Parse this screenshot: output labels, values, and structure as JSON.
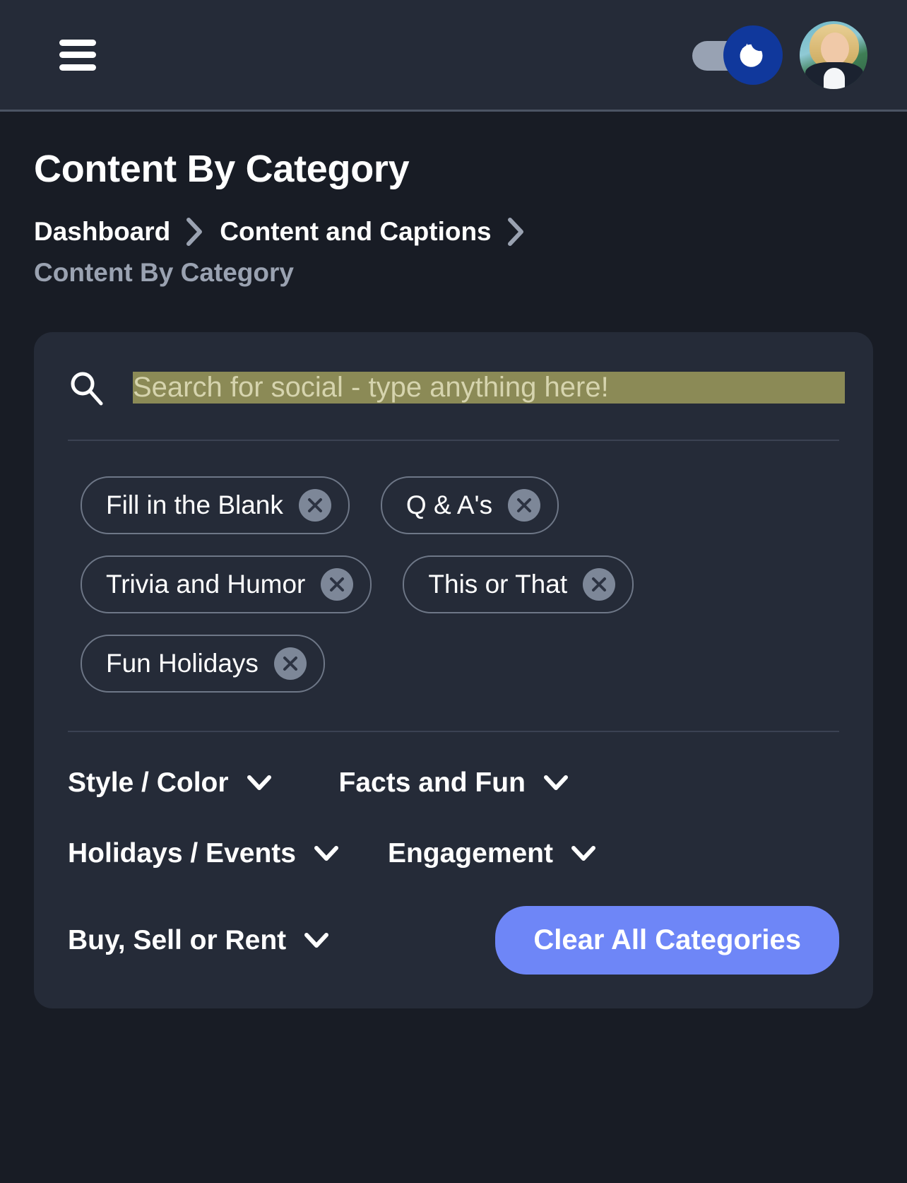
{
  "appbar": {
    "menu_icon": "hamburger-menu-icon",
    "dark_mode_toggle": {
      "icon": "moon-sparkle-icon",
      "state": "on",
      "knob_color": "#10389c",
      "track_color": "#98a2b3"
    },
    "avatar_alt": "user-avatar"
  },
  "page": {
    "title": "Content By Category"
  },
  "breadcrumb": {
    "items": [
      {
        "label": "Dashboard",
        "current": false
      },
      {
        "label": "Content and Captions",
        "current": false
      },
      {
        "label": "Content By Category",
        "current": true
      }
    ],
    "separator_icon": "chevron-right-icon"
  },
  "search": {
    "icon": "search-icon",
    "value": "",
    "placeholder": "Search for social - type anything here!",
    "placeholder_highlight_color": "#8b8a56",
    "placeholder_text_color": "#d6d4ae"
  },
  "chips": {
    "remove_icon": "close-circle-icon",
    "rows": [
      [
        {
          "label": "Fill in the Blank"
        },
        {
          "label": "Q & A's"
        }
      ],
      [
        {
          "label": "Trivia and Humor"
        },
        {
          "label": "This or That"
        }
      ],
      [
        {
          "label": "Fun Holidays"
        }
      ]
    ]
  },
  "dropdowns": {
    "caret_icon": "chevron-down-icon",
    "rows": [
      [
        {
          "label": "Style / Color"
        },
        {
          "label": "Facts and Fun"
        }
      ],
      [
        {
          "label": "Holidays / Events"
        },
        {
          "label": "Engagement"
        }
      ],
      [
        {
          "label": "Buy, Sell or Rent"
        }
      ]
    ]
  },
  "actions": {
    "clear_all_label": "Clear All Categories",
    "clear_all_color": "#6e86f7"
  }
}
